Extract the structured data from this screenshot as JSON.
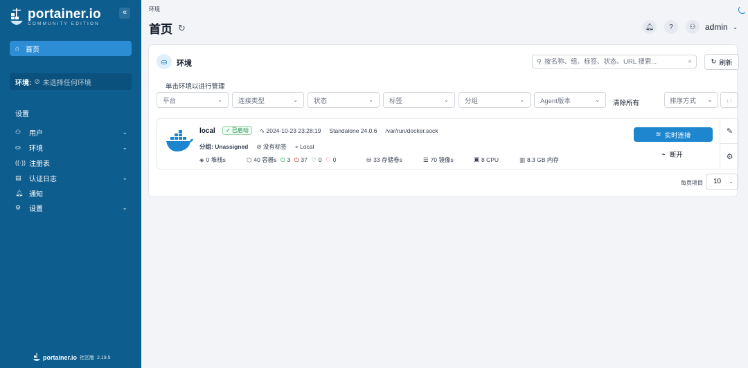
{
  "sidebar": {
    "logo_text": "portainer.io",
    "logo_sub": "COMMUNITY EDITION",
    "collapse_label": "«",
    "home_label": "首页",
    "env_label": "环境:",
    "env_value": "未选择任何环境",
    "settings_heading": "设置",
    "items": [
      {
        "label": "用户",
        "icon": "users-icon",
        "chevron": true
      },
      {
        "label": "环境",
        "icon": "environments-icon",
        "chevron": true
      },
      {
        "label": "注册表",
        "icon": "registry-icon",
        "chevron": false
      },
      {
        "label": "认证日志",
        "icon": "auth-logs-icon",
        "chevron": true
      },
      {
        "label": "通知",
        "icon": "bell-icon",
        "chevron": false
      },
      {
        "label": "设置",
        "icon": "gear-icon",
        "chevron": true
      }
    ],
    "footer_brand": "portainer.io",
    "footer_edition": "社区版",
    "footer_version": "2.19.5"
  },
  "header": {
    "breadcrumb": "环境",
    "title": "首页",
    "username": "admin"
  },
  "card": {
    "title": "环境",
    "search_placeholder": "按名称、组、标签、状态、URL 搜索...",
    "refresh_label": "刷新",
    "hint": "单击环境以进行管理",
    "filters": [
      "平台",
      "连接类型",
      "状态",
      "标签",
      "分组",
      "Agent版本"
    ],
    "clear_all": "清除所有",
    "sort_label": "排序方式",
    "per_page_label": "每页项目",
    "per_page_value": "10"
  },
  "environment": {
    "name": "local",
    "status": "已启动",
    "timestamp": "2024-10-23 23:28:19",
    "version": "Standalone 24.0.6",
    "socket": "/var/run/docker.sock",
    "group": "分组: Unassigned",
    "tags": "没有标签",
    "location": "Local",
    "stacks": "0 堆栈s",
    "containers": "40 容器s",
    "running": "3",
    "stopped": "37",
    "healthy": "0",
    "unhealthy": "0",
    "volumes": "33 存储卷s",
    "images": "70 镜像s",
    "cpu": "8 CPU",
    "memory": "8.3 GB 内存",
    "live_connect": "实时连接",
    "disconnect": "断开"
  },
  "colors": {
    "sidebar_bg": "#0d5d8f",
    "active_nav": "#2d8dd4",
    "primary_button": "#1d86cf",
    "status_green": "#16a34a",
    "status_red": "#dc2626"
  }
}
